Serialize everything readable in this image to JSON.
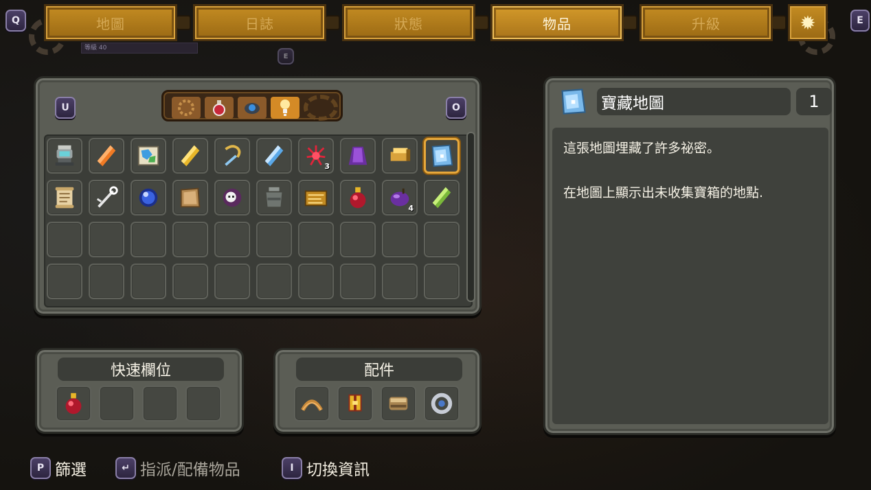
{
  "nav": {
    "left_key": "Q",
    "right_key": "E",
    "tabs": [
      {
        "label": "地圖",
        "active": false
      },
      {
        "label": "日誌",
        "active": false
      },
      {
        "label": "狀態",
        "active": false
      },
      {
        "label": "物品",
        "active": true
      },
      {
        "label": "升級",
        "active": false
      }
    ],
    "settings_icon": "gear-icon",
    "hud_level_label": "等級 40",
    "hud_key": "E"
  },
  "inventory": {
    "prev_key": "U",
    "next_key": "O",
    "filters": [
      {
        "icon": "all-items-icon",
        "active": false
      },
      {
        "icon": "potion-filter-icon",
        "active": false
      },
      {
        "icon": "gem-filter-icon",
        "active": false
      },
      {
        "icon": "key-item-filter-icon",
        "active": true
      }
    ],
    "items": [
      {
        "icon": "lantern-icon",
        "qty": ""
      },
      {
        "icon": "orange-crystal-icon",
        "qty": ""
      },
      {
        "icon": "world-map-icon",
        "qty": ""
      },
      {
        "icon": "gold-crystal-icon",
        "qty": ""
      },
      {
        "icon": "hook-staff-icon",
        "qty": ""
      },
      {
        "icon": "blue-crystal-icon",
        "qty": ""
      },
      {
        "icon": "red-coral-icon",
        "qty": "3"
      },
      {
        "icon": "purple-cloak-icon",
        "qty": ""
      },
      {
        "icon": "gold-key-icon",
        "qty": ""
      },
      {
        "icon": "treasure-map-icon",
        "qty": "",
        "selected": true
      },
      {
        "icon": "scroll-icon",
        "qty": ""
      },
      {
        "icon": "skeleton-key-icon",
        "qty": ""
      },
      {
        "icon": "blue-orb-icon",
        "qty": ""
      },
      {
        "icon": "old-map-icon",
        "qty": ""
      },
      {
        "icon": "skull-orb-icon",
        "qty": ""
      },
      {
        "icon": "stone-urn-icon",
        "qty": ""
      },
      {
        "icon": "golden-tablet-icon",
        "qty": ""
      },
      {
        "icon": "red-potion-icon",
        "qty": ""
      },
      {
        "icon": "purple-fruit-icon",
        "qty": "4"
      },
      {
        "icon": "green-crystal-icon",
        "qty": ""
      }
    ],
    "total_slots": 40
  },
  "quick_slots": {
    "title": "快速欄位",
    "slots": [
      "red-potion-icon",
      "",
      "",
      ""
    ]
  },
  "accessories": {
    "title": "配件",
    "slots": [
      "boomerang-icon",
      "gold-armor-icon",
      "gauntlet-icon",
      "silver-ring-icon"
    ]
  },
  "detail": {
    "name": "寶藏地圖",
    "count": "1",
    "icon": "treasure-map-icon",
    "description_1": "這張地圖埋藏了許多祕密。",
    "description_2": "在地圖上顯示出未收集寶箱的地點."
  },
  "hints": [
    {
      "key": "P",
      "label": "篩選",
      "dim": false
    },
    {
      "key": "↵",
      "label": "指派/配備物品",
      "dim": true
    },
    {
      "key": "I",
      "label": "切換資訊",
      "dim": false
    }
  ],
  "colors": {
    "tab_gold": "#c48c22",
    "panel_gray": "#5b5d55",
    "selection": "#e7a83b",
    "key_purple": "#4b3f66"
  }
}
